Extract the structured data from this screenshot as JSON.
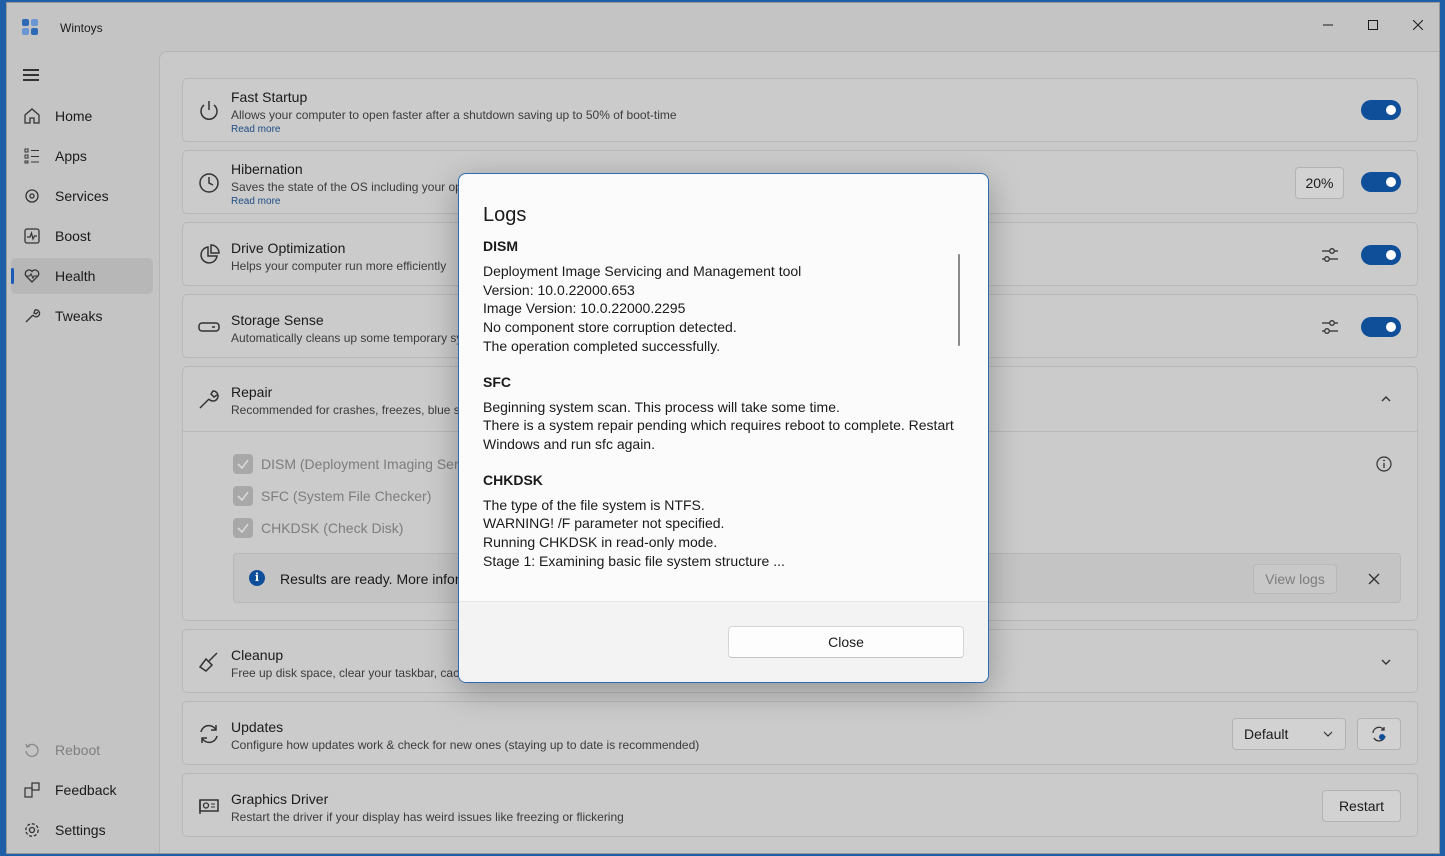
{
  "app": {
    "title": "Wintoys"
  },
  "sidebar": {
    "items": [
      {
        "label": "Home",
        "icon": "home-icon"
      },
      {
        "label": "Apps",
        "icon": "apps-icon"
      },
      {
        "label": "Services",
        "icon": "services-icon"
      },
      {
        "label": "Boost",
        "icon": "boost-icon"
      },
      {
        "label": "Health",
        "icon": "health-icon",
        "active": true
      },
      {
        "label": "Tweaks",
        "icon": "tweaks-icon"
      }
    ],
    "footer": [
      {
        "label": "Reboot",
        "icon": "reboot-icon",
        "disabled": true
      },
      {
        "label": "Feedback",
        "icon": "feedback-icon"
      },
      {
        "label": "Settings",
        "icon": "settings-icon"
      }
    ]
  },
  "cards": {
    "fast_startup": {
      "title": "Fast Startup",
      "desc": "Allows your computer to open faster after a shutdown saving up to 50% of boot-time",
      "read_more": "Read more",
      "enabled": true
    },
    "hibernation": {
      "title": "Hibernation",
      "desc": "Saves the state of the OS including your op",
      "read_more": "Read more",
      "size": "20%",
      "enabled": true
    },
    "drive_opt": {
      "title": "Drive Optimization",
      "desc": "Helps your computer run more efficiently",
      "enabled": true
    },
    "storage_sense": {
      "title": "Storage Sense",
      "desc": "Automatically cleans up some temporary sy",
      "enabled": true
    },
    "repair": {
      "title": "Repair",
      "desc": "Recommended for crashes, freezes, blue sc",
      "options": [
        "DISM (Deployment Imaging Serv",
        "SFC (System File Checker)",
        "CHKDSK (Check Disk)"
      ],
      "result_text": "Results are ready. More infor",
      "view_logs": "View logs"
    },
    "cleanup": {
      "title": "Cleanup",
      "desc": "Free up disk space, clear your taskbar, cach"
    },
    "updates": {
      "title": "Updates",
      "desc": "Configure how updates work & check for new ones (staying up to date is recommended)",
      "mode": "Default"
    },
    "graphics": {
      "title": "Graphics Driver",
      "desc": "Restart the driver if your display has weird issues like freezing or flickering",
      "action": "Restart"
    }
  },
  "dialog": {
    "title": "Logs",
    "sections": [
      {
        "heading": "DISM",
        "lines": [
          "Deployment Image Servicing and Management tool",
          "Version: 10.0.22000.653",
          "Image Version: 10.0.22000.2295",
          "No component store corruption detected.",
          "The operation completed successfully."
        ]
      },
      {
        "heading": "SFC",
        "lines": [
          "Beginning system scan.  This process will take some time.",
          "There is a system repair pending which requires reboot to complete.  Restart",
          "Windows and run sfc again."
        ]
      },
      {
        "heading": "CHKDSK",
        "lines": [
          "The type of the file system is NTFS.",
          "WARNING!  /F parameter not specified.",
          "Running CHKDSK in read-only mode.",
          "Stage 1: Examining basic file system structure ..."
        ]
      }
    ],
    "close_label": "Close"
  },
  "colors": {
    "accent": "#0f4f9a",
    "dialog_border": "#2f6ab7"
  }
}
